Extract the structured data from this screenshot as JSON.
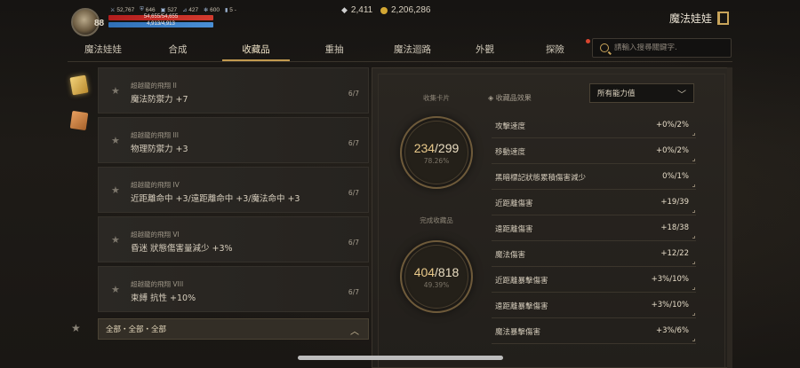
{
  "player": {
    "level": "88",
    "stats": [
      {
        "icon": "sword-icon",
        "value": "52,767"
      },
      {
        "icon": "shield-icon",
        "value": "646"
      },
      {
        "icon": "armor-icon",
        "value": "527"
      },
      {
        "icon": "boot-icon",
        "value": "427"
      },
      {
        "icon": "gear-icon",
        "value": "600"
      },
      {
        "icon": "bar-icon",
        "value": "5 -"
      }
    ],
    "hp_text": "54,655/54,655",
    "mp_text": "4,913/4,913"
  },
  "currency": {
    "diamond": "2,411",
    "gold": "2,206,286"
  },
  "window_title": "魔法娃娃",
  "tabs": [
    {
      "label": "魔法娃娃",
      "active": false
    },
    {
      "label": "合成",
      "active": false
    },
    {
      "label": "收藏品",
      "active": true
    },
    {
      "label": "重抽",
      "active": false
    },
    {
      "label": "魔法迴路",
      "active": false
    },
    {
      "label": "外觀",
      "active": false
    },
    {
      "label": "探險",
      "active": false
    }
  ],
  "search": {
    "placeholder": "請輸入搜尋關鍵字."
  },
  "collection_items": [
    {
      "subtitle": "超越龍的飛翔 II",
      "title": "魔法防禦力 +7",
      "count": "6/7"
    },
    {
      "subtitle": "超越龍的飛翔 III",
      "title": "物理防禦力 +3",
      "count": "6/7"
    },
    {
      "subtitle": "超越龍的飛翔 IV",
      "title": "近距離命中 +3/遠距離命中 +3/魔法命中 +3",
      "count": "6/7"
    },
    {
      "subtitle": "超越龍的飛翔 VI",
      "title": "昏迷 狀態傷害量減少 +3%",
      "count": "6/7"
    },
    {
      "subtitle": "超越龍的飛翔 VIII",
      "title": "束縛 抗性 +10%",
      "count": "6/7"
    }
  ],
  "filter": {
    "label": "全部・全部・全部"
  },
  "cards": {
    "label": "收集卡片",
    "collected": "234",
    "total": "/299",
    "percent": "78.26%"
  },
  "completed": {
    "label": "完成收藏品",
    "collected": "404",
    "total": "/818",
    "percent": "49.39%"
  },
  "effects": {
    "header": "◈ 收藏品效果",
    "dropdown": "所有能力值",
    "rows": [
      {
        "name": "攻擊速度",
        "value": "+0%/2%"
      },
      {
        "name": "移動速度",
        "value": "+0%/2%"
      },
      {
        "name": "黑暗標記狀態累積傷害減少",
        "value": "0%/1%"
      },
      {
        "name": "近距離傷害",
        "value": "+19/39"
      },
      {
        "name": "遠距離傷害",
        "value": "+18/38"
      },
      {
        "name": "魔法傷害",
        "value": "+12/22"
      },
      {
        "name": "近距離暴擊傷害",
        "value": "+3%/10%"
      },
      {
        "name": "遠距離暴擊傷害",
        "value": "+3%/10%"
      },
      {
        "name": "魔法暴擊傷害",
        "value": "+3%/6%"
      }
    ]
  },
  "colors": {
    "accent_gold": "#c29a4f",
    "hp_red": "#c82a24",
    "mp_blue": "#3b7fc6",
    "notification_red": "#d9452f"
  }
}
